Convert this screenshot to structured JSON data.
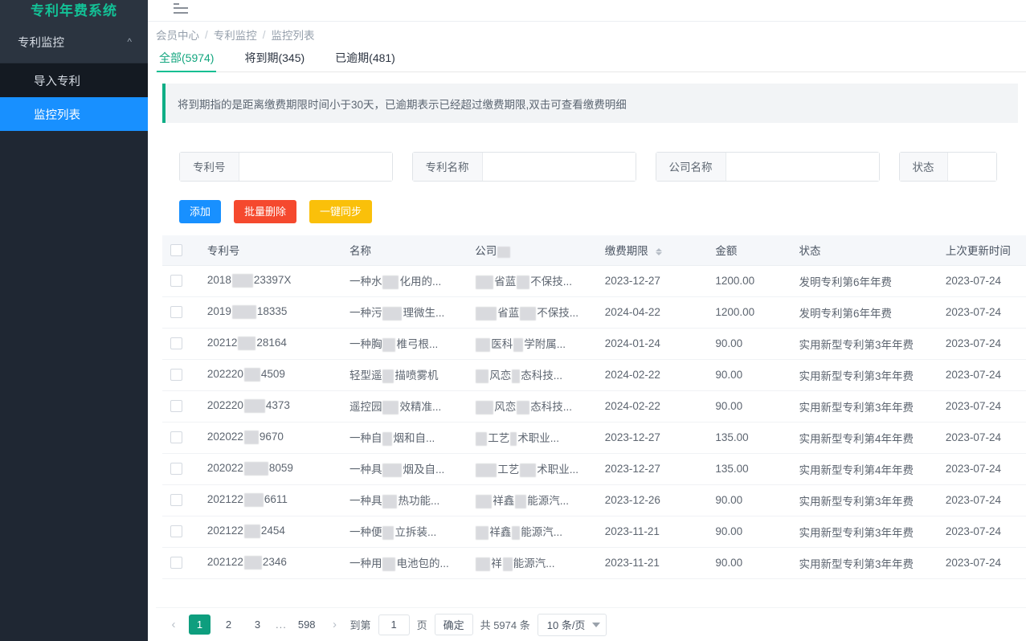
{
  "sidebar": {
    "brand": "专利年费系统",
    "group": {
      "label": "专利监控",
      "chevron": "chevron-up-icon"
    },
    "items": [
      {
        "label": "导入专利",
        "active": false
      },
      {
        "label": "监控列表",
        "active": true
      }
    ]
  },
  "breadcrumb": {
    "items": [
      "会员中心",
      "专利监控",
      "监控列表"
    ],
    "separator": "/"
  },
  "tabs": [
    {
      "label": "全部(5974)",
      "active": true
    },
    {
      "label": "将到期(345)",
      "active": false
    },
    {
      "label": "已逾期(481)",
      "active": false
    }
  ],
  "alert": {
    "text": "将到期指的是距离缴费期限时间小于30天，已逾期表示已经超过缴费期限,双击可查看缴费明细"
  },
  "search": {
    "fields": [
      {
        "label": "专利号",
        "value": "",
        "placeholder": ""
      },
      {
        "label": "专利名称",
        "value": "",
        "placeholder": ""
      },
      {
        "label": "公司名称",
        "value": "",
        "placeholder": ""
      },
      {
        "label": "状态",
        "value": "",
        "placeholder": ""
      }
    ]
  },
  "toolbar": {
    "add_label": "添加",
    "batch_delete_label": "批量删除",
    "sync_label": "一键同步",
    "add_color": "#1890ff",
    "batch_delete_color": "#f5492e",
    "sync_color": "#fac00a"
  },
  "table": {
    "columns": [
      "专利号",
      "名称",
      "公司",
      "缴费期限",
      "金额",
      "状态",
      "上次更新时间"
    ],
    "sortable_column": "缴费期限",
    "rows": [
      {
        "patent_no_prefix": "2018",
        "patent_no_suffix": "23397X",
        "name_prefix": "一种水",
        "name_suffix": "化用的...",
        "company_mid": "省蓝",
        "company_suffix": "不保技...",
        "due": "2023-12-27",
        "amount": "1200.00",
        "status": "发明专利第6年年费",
        "updated": "2023-07-24"
      },
      {
        "patent_no_prefix": "2019",
        "patent_no_suffix": "18335",
        "name_prefix": "一种污",
        "name_suffix": "理微生...",
        "company_mid": "省蓝",
        "company_suffix": "不保技...",
        "due": "2024-04-22",
        "amount": "1200.00",
        "status": "发明专利第6年年费",
        "updated": "2023-07-24"
      },
      {
        "patent_no_prefix": "20212",
        "patent_no_suffix": "28164",
        "name_prefix": "一种胸",
        "name_suffix": "椎弓根...",
        "company_mid": "医科",
        "company_suffix": "学附属...",
        "due": "2024-01-24",
        "amount": "90.00",
        "status": "实用新型专利第3年年费",
        "updated": "2023-07-24"
      },
      {
        "patent_no_prefix": "202220",
        "patent_no_suffix": "4509",
        "name_prefix": "轻型遥",
        "name_suffix": "描喷雾机",
        "company_mid": "风恋",
        "company_suffix": "态科技...",
        "due": "2024-02-22",
        "amount": "90.00",
        "status": "实用新型专利第3年年费",
        "updated": "2023-07-24"
      },
      {
        "patent_no_prefix": "202220",
        "patent_no_suffix": "4373",
        "name_prefix": "遥控园",
        "name_suffix": "效精准...",
        "company_mid": "风恋",
        "company_suffix": "态科技...",
        "due": "2024-02-22",
        "amount": "90.00",
        "status": "实用新型专利第3年年费",
        "updated": "2023-07-24"
      },
      {
        "patent_no_prefix": "202022",
        "patent_no_suffix": "9670",
        "name_prefix": "一种自",
        "name_suffix": "烟和自...",
        "company_mid": "工艺",
        "company_suffix": "术职业...",
        "due": "2023-12-27",
        "amount": "135.00",
        "status": "实用新型专利第4年年费",
        "updated": "2023-07-24"
      },
      {
        "patent_no_prefix": "202022",
        "patent_no_suffix": "8059",
        "name_prefix": "一种具",
        "name_suffix": "烟及自...",
        "company_mid": "工艺",
        "company_suffix": "术职业...",
        "due": "2023-12-27",
        "amount": "135.00",
        "status": "实用新型专利第4年年费",
        "updated": "2023-07-24"
      },
      {
        "patent_no_prefix": "202122",
        "patent_no_suffix": "6611",
        "name_prefix": "一种具",
        "name_suffix": "热功能...",
        "company_mid": "祥鑫",
        "company_suffix": "能源汽...",
        "due": "2023-12-26",
        "amount": "90.00",
        "status": "实用新型专利第3年年费",
        "updated": "2023-07-24"
      },
      {
        "patent_no_prefix": "202122",
        "patent_no_suffix": "2454",
        "name_prefix": "一种便",
        "name_suffix": "立拆装...",
        "company_mid": "祥鑫",
        "company_suffix": "能源汽...",
        "due": "2023-11-21",
        "amount": "90.00",
        "status": "实用新型专利第3年年费",
        "updated": "2023-07-24"
      },
      {
        "patent_no_prefix": "202122",
        "patent_no_suffix": "2346",
        "name_prefix": "一种用",
        "name_suffix": "电池包的...",
        "company_mid": "祥",
        "company_suffix": "能源汽...",
        "due": "2023-11-21",
        "amount": "90.00",
        "status": "实用新型专利第3年年费",
        "updated": "2023-07-24"
      }
    ]
  },
  "pagination": {
    "prev_icon": "chevron-left-icon",
    "next_icon": "chevron-right-icon",
    "pages": [
      "1",
      "2",
      "3"
    ],
    "ellipsis": "...",
    "last_page": "598",
    "current_page": "1",
    "jump_prefix": "到第",
    "jump_value": "1",
    "jump_suffix": "页",
    "confirm_label": "确定",
    "total_label": "共 5974 条",
    "page_size_label": "10 条/页",
    "active_color": "#0e9e7e"
  }
}
